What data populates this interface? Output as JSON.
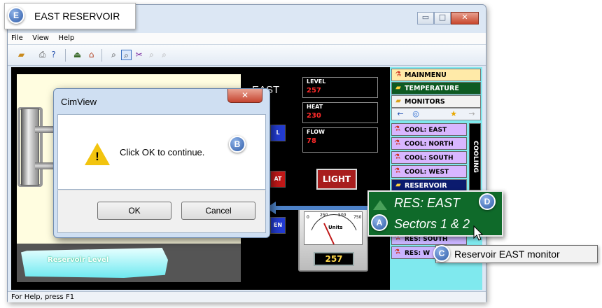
{
  "window": {
    "title": "EAST RESERVOIR",
    "title_badge": "E",
    "controls": {
      "minimize": "▭",
      "maximize": "□",
      "close": "✕"
    },
    "menu": [
      "File",
      "View",
      "Help"
    ],
    "status": "For Help, press F1"
  },
  "toolbar": {
    "icons": [
      "open-folder-icon",
      "print-icon",
      "help-pointer-icon",
      "up-level-icon",
      "home-icon",
      "zoom-icon",
      "zoom-box-icon",
      "tools-icon",
      "zoom-in-icon",
      "zoom-out-icon"
    ]
  },
  "canvas": {
    "heading": "EAST",
    "readouts": [
      {
        "label": "LEVEL",
        "value": "257"
      },
      {
        "label": "HEAT",
        "value": "230"
      },
      {
        "label": "FLOW",
        "value": "78"
      }
    ],
    "light_label": "LIGHT",
    "side_buttons": [
      "L",
      "AT",
      "EN"
    ],
    "reservoir_label": "Reservoir Level",
    "gauge": {
      "units": "Units",
      "value": "257",
      "ticks": [
        "0",
        "250",
        "500",
        "750"
      ]
    }
  },
  "sidebar": {
    "mainmenu": "MAINMENU",
    "temperature": "TEMPERATURE",
    "monitors": "MONITORS",
    "nav": [
      "←",
      "◎",
      "",
      "★",
      "→"
    ],
    "cool_items": [
      "COOL: EAST",
      "COOL: NORTH",
      "COOL: SOUTH",
      "COOL: WEST"
    ],
    "cooling_tab": "COOLING",
    "reservoir": "RESERVOIR",
    "res_items": [
      "RES: SOUTH",
      "RES: W"
    ]
  },
  "dialog": {
    "title": "CimView",
    "close": "✕",
    "message": "Click OK to continue.",
    "ok": "OK",
    "cancel": "Cancel",
    "badge": "B"
  },
  "callout": {
    "line1": "RES: EAST",
    "line2": "Sectors 1 & 2",
    "badge_a": "A",
    "badge_d": "D"
  },
  "tooltip": {
    "text": "Reservoir EAST monitor",
    "badge": "C"
  },
  "colors": {
    "accent_blue": "#2f5ca8",
    "callout_green": "#0f6a2a",
    "readout_red": "#ff2a2a",
    "sidebar_cyan": "#7fe9ee",
    "cool_purple": "#d8b6ff"
  }
}
